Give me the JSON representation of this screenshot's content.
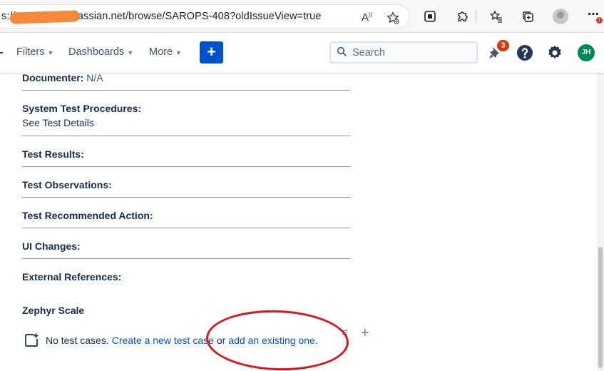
{
  "browser": {
    "url": "s://usc.........s.atlassian.net/browse/SAROPS-408?oldIssueView=true",
    "menu_dots": "⋯",
    "alert_mark": "!"
  },
  "jira_nav": {
    "filters": "Filters",
    "dashboards": "Dashboards",
    "more": "More",
    "create": "+",
    "search_placeholder": "Search",
    "notification_count": "3",
    "user_initials": "JH"
  },
  "fields": [
    {
      "label": "Documenter:",
      "value": "N/A"
    },
    {
      "label": "System Test Procedures:",
      "value": "See Test Details"
    },
    {
      "label": "Test Results:",
      "value": ""
    },
    {
      "label": "Test Observations:",
      "value": ""
    },
    {
      "label": "Test Recommended Action:",
      "value": ""
    },
    {
      "label": "UI Changes:",
      "value": ""
    },
    {
      "label": "External References:",
      "value": ""
    }
  ],
  "zephyr": {
    "title": "Zephyr Scale",
    "no_cases": "No test cases.",
    "create_link": "Create a new test case",
    "or": "or",
    "add_link": "add an existing one.",
    "menu_glyph": "≡",
    "add_glyph": "+"
  },
  "colors": {
    "brand_blue": "#0052cc",
    "badge_red": "#de350b",
    "avatar_green": "#00875a",
    "annotation_red": "#e3131c",
    "redaction_orange": "#f6883a"
  }
}
